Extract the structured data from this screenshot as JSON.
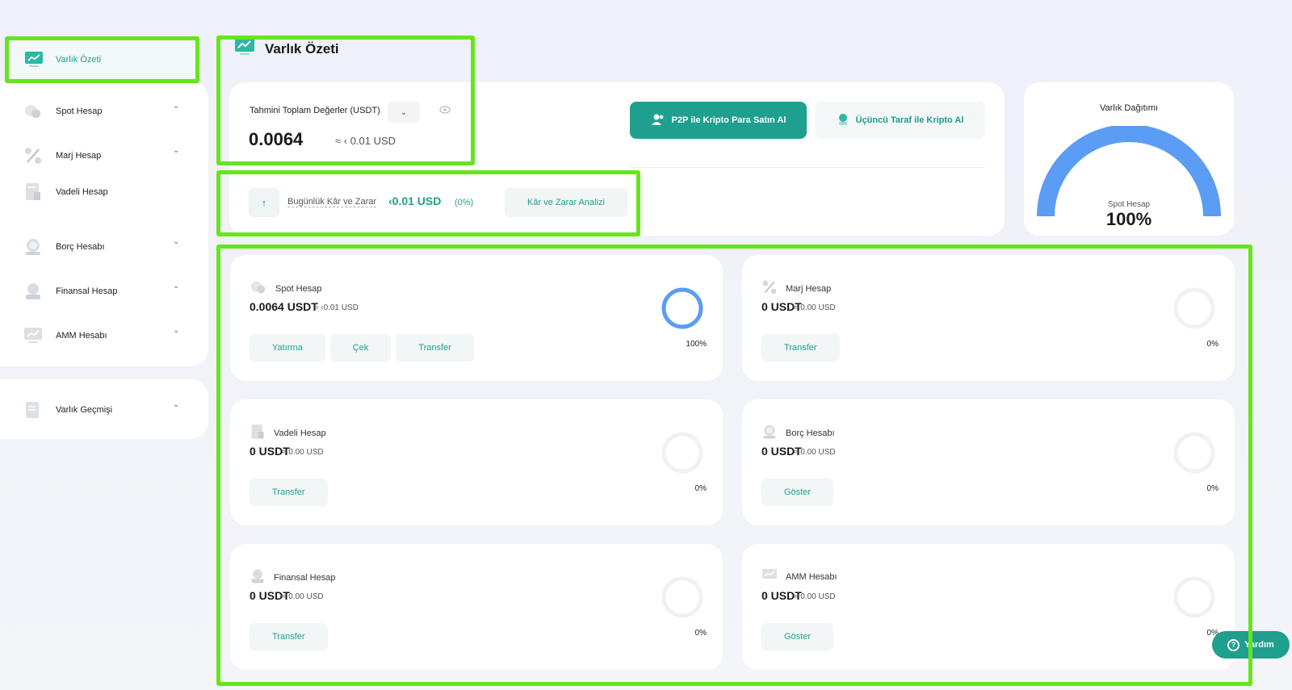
{
  "sidebar": {
    "items": [
      {
        "label": "Varlık Özeti",
        "icon": "chart-monitor-icon",
        "active": true
      },
      {
        "label": "Spot Hesap",
        "icon": "coins-icon"
      },
      {
        "label": "Marj Hesap",
        "icon": "percent-icon"
      },
      {
        "label": "Vadeli Hesap",
        "icon": "document-icon"
      },
      {
        "label": "Borç Hesabı",
        "icon": "loan-icon"
      },
      {
        "label": "Finansal Hesap",
        "icon": "finance-icon"
      },
      {
        "label": "AMM Hesabı",
        "icon": "amm-monitor-icon"
      }
    ],
    "history": {
      "label": "Varlık Geçmişi",
      "icon": "history-document-icon"
    }
  },
  "page": {
    "title": "Varlık Özeti"
  },
  "summary": {
    "estimated_label": "Tahmini Toplam Değerler (USDT)",
    "total_value": "0.0064",
    "approx_usd": "≈ ‹ 0.01 USD",
    "p2p_button": "P2P ile Kripto Para Satın Al",
    "third_party_button": "Üçüncü Taraf ile Kripto Al",
    "pnl_label": "Bugünlük Kâr ve Zarar",
    "pnl_value": "‹0.01 USD",
    "pnl_percent": "(0%)",
    "pnl_button": "Kâr ve Zarar Analizi"
  },
  "distribution": {
    "title": "Varlık Dağıtımı",
    "sub_label": "Spot Hesap",
    "percent_label": "100%",
    "share": 1.0
  },
  "accounts": [
    {
      "name": "Spot Hesap",
      "icon": "coins-icon",
      "value": "0.0064 USDT",
      "approx": "≈ ‹0.01 USD",
      "buttons": [
        "Yatırma",
        "Çek",
        "Transfer"
      ],
      "percent": "100%",
      "share": 1.0
    },
    {
      "name": "Marj Hesap",
      "icon": "percent-icon",
      "value": "0 USDT",
      "approx": "≈ 0.00 USD",
      "buttons": [
        "Transfer"
      ],
      "percent": "0%",
      "share": 0
    },
    {
      "name": "Vadeli Hesap",
      "icon": "document-icon",
      "value": "0 USDT",
      "approx": "≈ 0.00 USD",
      "buttons": [
        "Transfer"
      ],
      "percent": "0%",
      "share": 0
    },
    {
      "name": "Borç Hesabı",
      "icon": "loan-icon",
      "value": "0 USDT",
      "approx": "≈ 0.00 USD",
      "buttons": [
        "Göster"
      ],
      "percent": "0%",
      "share": 0
    },
    {
      "name": "Finansal Hesap",
      "icon": "finance-icon",
      "value": "0 USDT",
      "approx": "≈ 0.00 USD",
      "buttons": [
        "Transfer"
      ],
      "percent": "0%",
      "share": 0
    },
    {
      "name": "AMM Hesabı",
      "icon": "amm-monitor-icon",
      "value": "0 USDT",
      "approx": "≈ 0.00 USD",
      "buttons": [
        "Göster"
      ],
      "percent": "0%",
      "share": 0
    }
  ],
  "help": {
    "label": "Yardım"
  },
  "colors": {
    "accent": "#1f9f8d",
    "gauge": "#5b9cf4",
    "highlight": "#66e51c"
  }
}
